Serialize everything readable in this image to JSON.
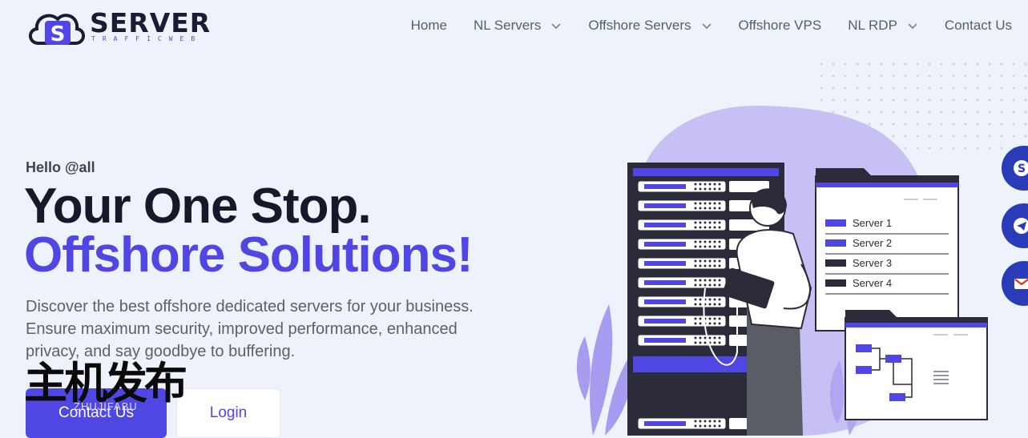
{
  "brand": {
    "name": "SERVER",
    "tagline": "TRAFFICWEB"
  },
  "nav": [
    {
      "label": "Home",
      "dropdown": false
    },
    {
      "label": "NL Servers",
      "dropdown": true
    },
    {
      "label": "Offshore Servers",
      "dropdown": true
    },
    {
      "label": "Offshore VPS",
      "dropdown": false
    },
    {
      "label": "NL RDP",
      "dropdown": true
    },
    {
      "label": "Contact Us",
      "dropdown": false
    }
  ],
  "hero": {
    "greeting": "Hello @all",
    "headline_1": "Your One Stop.",
    "headline_2": "Offshore Solutions!",
    "description": "Discover the best offshore dedicated servers for your business. Ensure maximum security, improved performance, enhanced privacy, and say goodbye to buffering.",
    "primary_button": "Contact Us",
    "secondary_button": "Login"
  },
  "illustration": {
    "server_list": [
      "Server 1",
      "Server 2",
      "Server 3",
      "Server 4"
    ]
  },
  "social": [
    "skype-icon",
    "telegram-icon",
    "gmail-icon"
  ],
  "watermark": {
    "big": "主机发布",
    "small": "ZHUJIFABU"
  },
  "colors": {
    "accent": "#5046e4",
    "background": "#eef3fb",
    "heading": "#151a2b",
    "body_text": "#59616c",
    "nav_text": "#55606e"
  }
}
